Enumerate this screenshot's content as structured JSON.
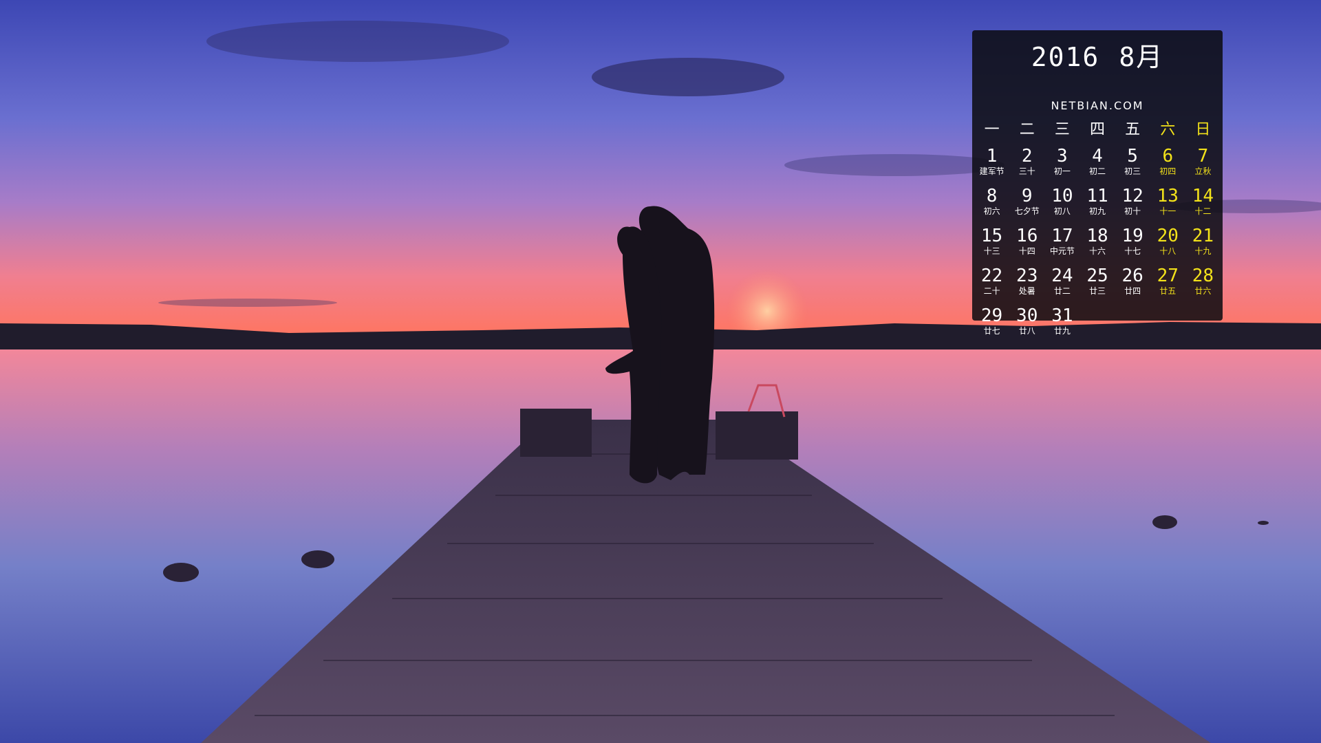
{
  "calendar": {
    "year": "2016",
    "month": "8月",
    "site": "NETBIAN.COM",
    "weekdays": [
      "一",
      "二",
      "三",
      "四",
      "五",
      "六",
      "日"
    ],
    "weekend_color": "#f3e21a",
    "start_weekday_index": 0,
    "days": [
      {
        "n": "1",
        "l": "建军节"
      },
      {
        "n": "2",
        "l": "三十"
      },
      {
        "n": "3",
        "l": "初一"
      },
      {
        "n": "4",
        "l": "初二"
      },
      {
        "n": "5",
        "l": "初三"
      },
      {
        "n": "6",
        "l": "初四"
      },
      {
        "n": "7",
        "l": "立秋"
      },
      {
        "n": "8",
        "l": "初六"
      },
      {
        "n": "9",
        "l": "七夕节"
      },
      {
        "n": "10",
        "l": "初八"
      },
      {
        "n": "11",
        "l": "初九"
      },
      {
        "n": "12",
        "l": "初十"
      },
      {
        "n": "13",
        "l": "十一"
      },
      {
        "n": "14",
        "l": "十二"
      },
      {
        "n": "15",
        "l": "十三"
      },
      {
        "n": "16",
        "l": "十四"
      },
      {
        "n": "17",
        "l": "中元节"
      },
      {
        "n": "18",
        "l": "十六"
      },
      {
        "n": "19",
        "l": "十七"
      },
      {
        "n": "20",
        "l": "十八"
      },
      {
        "n": "21",
        "l": "十九"
      },
      {
        "n": "22",
        "l": "二十"
      },
      {
        "n": "23",
        "l": "处暑"
      },
      {
        "n": "24",
        "l": "廿二"
      },
      {
        "n": "25",
        "l": "廿三"
      },
      {
        "n": "26",
        "l": "廿四"
      },
      {
        "n": "27",
        "l": "廿五"
      },
      {
        "n": "28",
        "l": "廿六"
      },
      {
        "n": "29",
        "l": "廿七"
      },
      {
        "n": "30",
        "l": "廿八"
      },
      {
        "n": "31",
        "l": "廿九"
      }
    ]
  }
}
